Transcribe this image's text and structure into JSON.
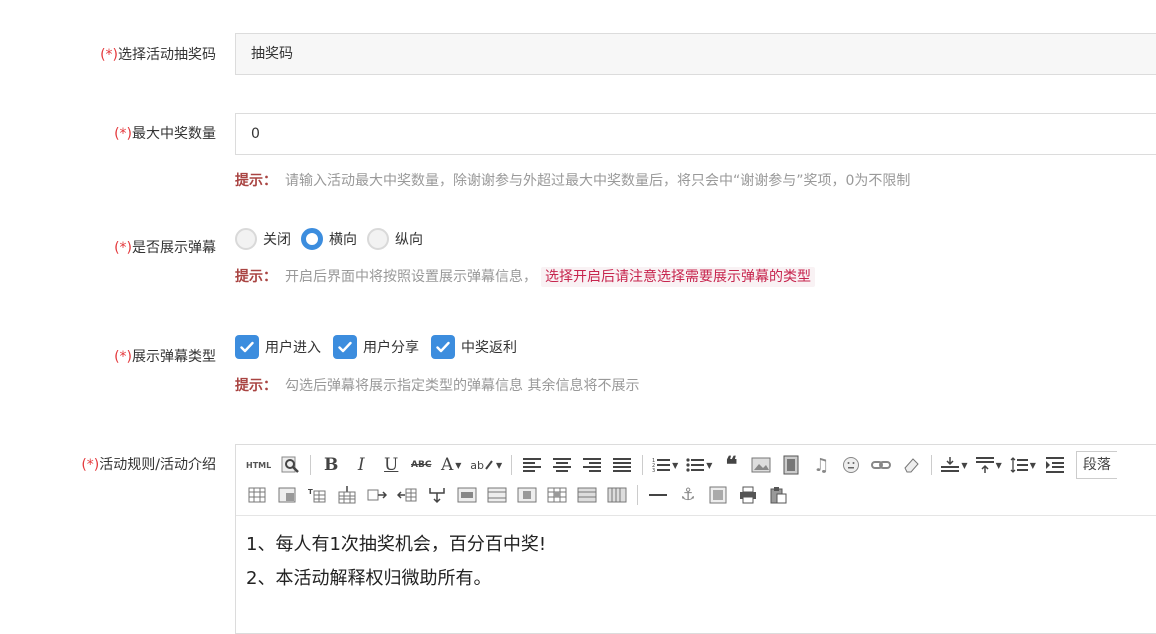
{
  "required_mark": "(*)",
  "fields": {
    "code": {
      "label": "选择活动抽奖码",
      "value": "抽奖码"
    },
    "max_win": {
      "label": "最大中奖数量",
      "value": "0",
      "hint_tag": "提示：",
      "hint": "请输入活动最大中奖数量，除谢谢参与外超过最大中奖数量后，将只会中“谢谢参与”奖项，0为不限制"
    },
    "barrage": {
      "label": "是否展示弹幕",
      "options": [
        "关闭",
        "横向",
        "纵向"
      ],
      "selected": "横向",
      "hint_tag": "提示：",
      "hint": "开启后界面中将按照设置展示弹幕信息，",
      "hint_mark": "选择开启后请注意选择需要展示弹幕的类型"
    },
    "barrage_type": {
      "label": "展示弹幕类型",
      "options": [
        "用户进入",
        "用户分享",
        "中奖返利"
      ],
      "checked": [
        true,
        true,
        true
      ],
      "hint_tag": "提示：",
      "hint": "勾选后弹幕将展示指定类型的弹幕信息 其余信息将不展示"
    },
    "rules": {
      "label": "活动规则/活动介绍",
      "paragraph_select": "段落",
      "html_btn": "HTML",
      "lines": [
        "1、每人有1次抽奖机会，百分百中奖!",
        "2、本活动解释权归微助所有。"
      ]
    }
  },
  "colors": {
    "required": "#e4393c",
    "accent": "#3c8dde",
    "hint_tag": "#a94442",
    "hint_mark": "#c7254e"
  }
}
